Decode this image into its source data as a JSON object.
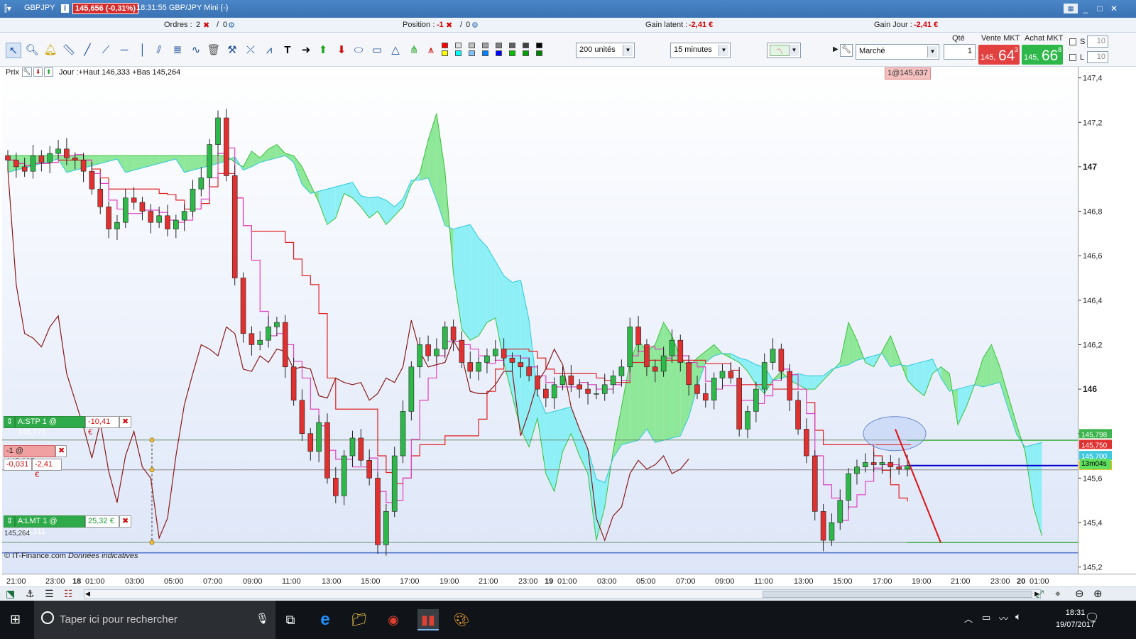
{
  "window": {
    "symbol": "GBPJPY",
    "price_box": "145,656 (-0,31%)",
    "title": "18:31:55 GBP/JPY Mini (-)"
  },
  "infobar": {
    "orders_label": "Ordres :",
    "orders_count": "2",
    "orders_sep": "/",
    "orders_zero": "0",
    "position_label": "Position :",
    "position_value": "-1",
    "position_sep": "/",
    "position_zero": "0",
    "gain_latent_label": "Gain latent :",
    "gain_latent_value": "-2,41 €",
    "gain_jour_label": "Gain Jour :",
    "gain_jour_value": "-2,41 €"
  },
  "toolbar": {
    "units_select": "200 unités",
    "timeframe_select": "15 minutes",
    "order_type_select": "Marché",
    "qty_label": "Qté",
    "qty_value": "1",
    "sell_label": "Vente MKT",
    "sell_small": "145,",
    "sell_big": "64",
    "sell_sup": "3",
    "buy_label": "Achat MKT",
    "buy_small": "145,",
    "buy_big": "66",
    "buy_sup": "8",
    "s_label": "S",
    "l_label": "L",
    "s_value": "10",
    "l_value": "10",
    "swatch_colors": [
      "#ff0000",
      "#e0e0e0",
      "#c0c0c0",
      "#a0a0a0",
      "#808080",
      "#606060",
      "#404040",
      "#000000",
      "#ffff00",
      "#00ffff",
      "#80c0ff",
      "#0080ff",
      "#0000ff",
      "#00c000",
      "#00a000",
      "#008000"
    ]
  },
  "chart": {
    "prix_label": "Prix",
    "day_range": "Jour :+Haut 146,333 +Bas 145,264",
    "position_tag": "1@145,637",
    "stop_label": "A:STP  1 @ 145,771",
    "stop_gain": "-10,41 €",
    "pos_label": "-1 @ 145,637",
    "pos_diff": "-0,031",
    "pos_gain": "-2,41 €",
    "lmt_label": "A:LMT  1 @ 145,311",
    "lmt_gain": "25,32 €",
    "low_label": "145,264",
    "copyright": "© IT-Finance.com",
    "data_note": "Données indicatives",
    "countdown": "13m04s"
  },
  "chart_data": {
    "type": "candlestick",
    "instrument": "GBP/JPY",
    "timeframe": "15 minutes",
    "y_ticks": [
      "147,4",
      "147,2",
      "147",
      "146,8",
      "146,6",
      "146,4",
      "146,2",
      "146",
      "145,8",
      "145,6",
      "145,4",
      "145,2"
    ],
    "ylim": [
      145.17,
      147.45
    ],
    "price_tags": [
      {
        "label": "145,798",
        "value": 145.798,
        "color": "#3cb44b"
      },
      {
        "label": "145,750",
        "value": 145.75,
        "color": "#e03030"
      },
      {
        "label": "145,700",
        "value": 145.7,
        "color": "#40c8e0"
      },
      {
        "label": "145,656",
        "value": 145.656,
        "color": "#f4b400"
      }
    ],
    "x_ticks": [
      "21:00",
      "23:00",
      "18",
      "01:00",
      "03:00",
      "05:00",
      "07:00",
      "09:00",
      "11:00",
      "13:00",
      "15:00",
      "17:00",
      "19:00",
      "21:00",
      "23:00",
      "19",
      "01:00",
      "03:00",
      "05:00",
      "07:00",
      "09:00",
      "11:00",
      "13:00",
      "15:00",
      "17:00",
      "19:00",
      "21:00",
      "23:00",
      "20",
      "01:00"
    ],
    "levels": {
      "stop": 145.771,
      "position": 145.637,
      "limit": 145.311,
      "current": 145.656,
      "low": 145.264
    },
    "close_series": [
      147.03,
      147.0,
      146.98,
      147.05,
      147.02,
      147.06,
      147.08,
      147.04,
      147.03,
      146.98,
      146.9,
      146.82,
      146.72,
      146.75,
      146.86,
      146.84,
      146.8,
      146.75,
      146.78,
      146.72,
      146.76,
      146.8,
      146.9,
      146.95,
      147.1,
      147.22,
      146.96,
      146.5,
      146.25,
      146.2,
      146.22,
      146.28,
      146.3,
      146.1,
      145.95,
      145.8,
      145.72,
      145.85,
      145.6,
      145.52,
      145.7,
      145.78,
      145.68,
      145.6,
      145.3,
      145.45,
      145.7,
      145.9,
      146.1,
      146.2,
      146.15,
      146.18,
      146.28,
      146.22,
      146.12,
      146.08,
      146.12,
      146.15,
      146.18,
      146.14,
      146.12,
      146.1,
      146.06,
      146.0,
      145.96,
      146.02,
      146.06,
      146.02,
      146.0,
      145.98,
      145.98,
      146.02,
      146.06,
      146.1,
      146.28,
      146.2,
      146.1,
      146.08,
      146.15,
      146.22,
      146.12,
      146.02,
      145.98,
      145.95,
      146.05,
      146.08,
      146.05,
      145.82,
      145.9,
      146.0,
      146.12,
      146.18,
      146.08,
      145.95,
      145.82,
      145.7,
      145.45,
      145.32,
      145.4,
      145.5,
      145.62,
      145.65,
      145.67,
      145.66,
      145.67,
      145.65,
      145.64,
      145.656
    ]
  },
  "taskbar": {
    "search_placeholder": "Taper ici pour rechercher",
    "time": "18:31",
    "date": "19/07/2017"
  }
}
